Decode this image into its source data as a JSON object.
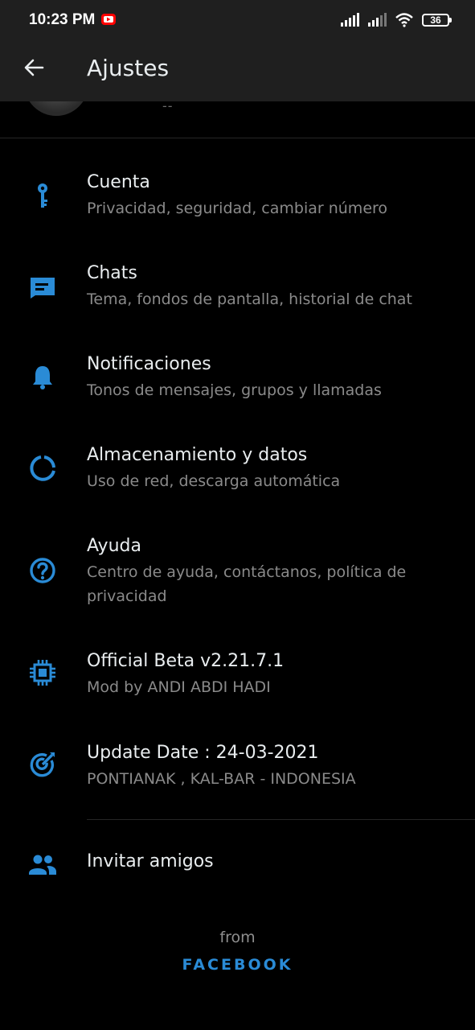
{
  "status_bar": {
    "time": "10:23 PM",
    "battery": "36"
  },
  "app_bar": {
    "title": "Ajustes"
  },
  "profile": {
    "status": "--"
  },
  "settings": [
    {
      "title": "Cuenta",
      "subtitle": "Privacidad, seguridad, cambiar número",
      "icon": "key-icon"
    },
    {
      "title": "Chats",
      "subtitle": "Tema, fondos de pantalla, historial de chat",
      "icon": "chat-icon"
    },
    {
      "title": "Notificaciones",
      "subtitle": "Tonos de mensajes, grupos y llamadas",
      "icon": "bell-icon"
    },
    {
      "title": "Almacenamiento y datos",
      "subtitle": "Uso de red, descarga automática",
      "icon": "data-usage-icon"
    },
    {
      "title": "Ayuda",
      "subtitle": "Centro de ayuda, contáctanos, política de privacidad",
      "icon": "help-icon"
    },
    {
      "title": "Official Beta v2.21.7.1",
      "subtitle": "Mod by ANDI ABDI HADI",
      "icon": "chip-icon"
    },
    {
      "title": "Update Date : 24-03-2021",
      "subtitle": "PONTIANAK , KAL-BAR - INDONESIA",
      "icon": "target-icon"
    }
  ],
  "invite": {
    "label": "Invitar amigos",
    "icon": "people-icon"
  },
  "footer": {
    "from": "from",
    "brand": "FACEBOOK"
  },
  "colors": {
    "accent": "#2a8bd6",
    "background": "#000000",
    "bar": "#1f1f1f"
  }
}
